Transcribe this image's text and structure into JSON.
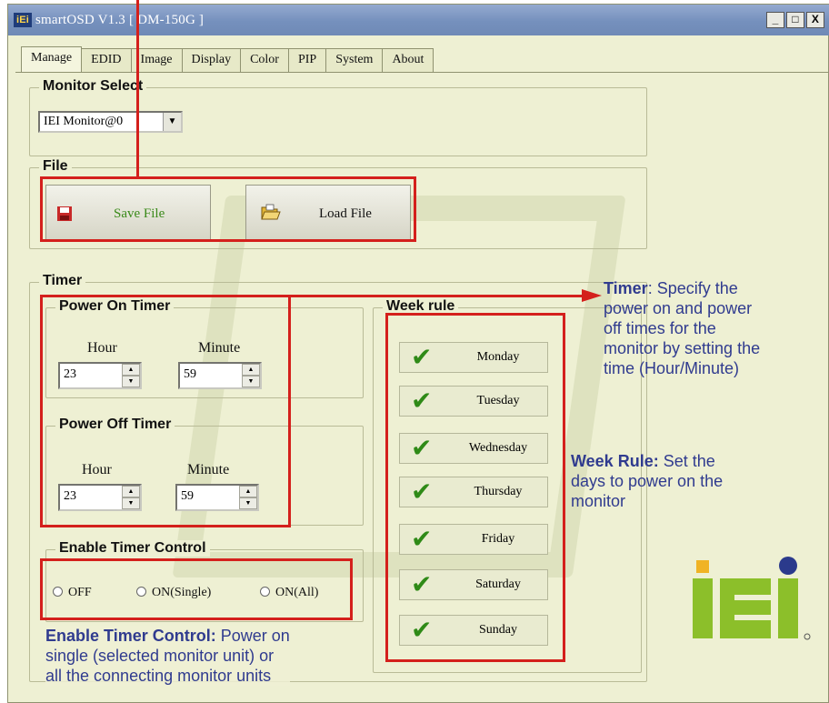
{
  "window": {
    "logo": "iEi",
    "title": "smartOSD V1.3 [ DM-150G ]",
    "btn_min": "_",
    "btn_max": "□",
    "btn_close": "X"
  },
  "tabs": [
    "Manage",
    "EDID",
    "Image",
    "Display",
    "Color",
    "PIP",
    "System",
    "About"
  ],
  "monitor_select": {
    "label": "Monitor Select",
    "value": "IEI Monitor@0",
    "arrow": "▼"
  },
  "file": {
    "label": "File",
    "save": "Save File",
    "load": "Load File"
  },
  "timer": {
    "label": "Timer",
    "power_on": {
      "label": "Power On Timer",
      "hour_label": "Hour",
      "minute_label": "Minute",
      "hour": "23",
      "minute": "59"
    },
    "power_off": {
      "label": "Power Off Timer",
      "hour_label": "Hour",
      "minute_label": "Minute",
      "hour": "23",
      "minute": "59"
    },
    "enable": {
      "label": "Enable Timer Control",
      "off": "OFF",
      "single": "ON(Single)",
      "all": "ON(All)"
    }
  },
  "week_rule": {
    "label": "Week rule",
    "check": "✔",
    "days": [
      "Monday",
      "Tuesday",
      "Wednesday",
      "Thursday",
      "Friday",
      "Saturday",
      "Sunday"
    ]
  },
  "annotations": {
    "timer_title": "Timer",
    "timer_text_1": ": Specify the",
    "timer_text_2": "power on and power",
    "timer_text_3": "off times for the",
    "timer_text_4": "monitor by setting the",
    "timer_text_5": "time (Hour/Minute)",
    "week_title": "Week Rule:",
    "week_text_1": " Set the",
    "week_text_2": "days to power on the",
    "week_text_3": "monitor",
    "enable_title": "Enable Timer Control:",
    "enable_text_1": " Power on",
    "enable_text_2": "single (selected monitor unit) or",
    "enable_text_3": "all the connecting monitor units"
  },
  "colors": {
    "highlight": "#d4201c",
    "annotation": "#303b8f",
    "logo_green": "#8cbf2a",
    "logo_blue": "#2b3a8c",
    "check": "#2f8a17"
  }
}
